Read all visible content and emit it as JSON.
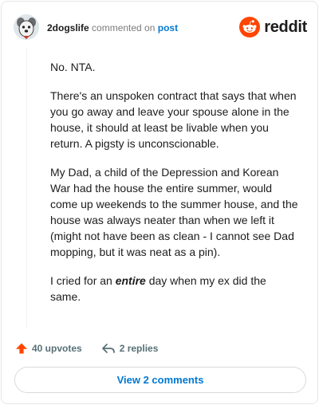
{
  "comment": {
    "username": "2dogslife",
    "action_text": "commented on",
    "target_text": "post",
    "paragraphs": [
      "No. NTA.",
      "There's an unspoken contract that says that when you go away and leave your spouse alone in the house, it should at least be livable when you return. A pigsty is unconscionable.",
      "My Dad, a child of the Depression and Korean War had the house the entire summer, would come up weekends to the summer house, and the house was always neater than when we left it (might not have been as clean - I cannot see Dad mopping, but it was neat as a pin)."
    ],
    "last_paragraph": {
      "before": "I cried for an ",
      "emphasis": "entire",
      "after": " day when my ex did the same."
    }
  },
  "brand": {
    "wordmark": "reddit",
    "icon": "reddit-snoo-icon",
    "color": "#ff4500"
  },
  "actions": {
    "upvotes_label": "40 upvotes",
    "replies_label": "2 replies",
    "upvote_icon": "upvote-arrow-icon",
    "reply_icon": "reply-arrow-icon"
  },
  "footer": {
    "view_comments_label": "View 2 comments"
  },
  "colors": {
    "link": "#0079d3",
    "upvote": "#ff4500",
    "muted": "#576f76"
  }
}
